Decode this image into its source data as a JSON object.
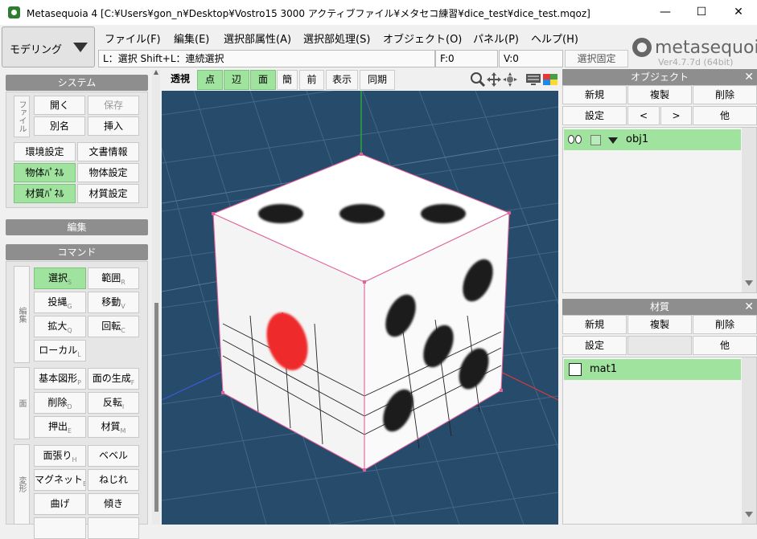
{
  "window": {
    "title": "Metasequoia 4 [C:¥Users¥gon_n¥Desktop¥Vostro15 3000 アクティブファイル¥メタセコ練習¥dice_test¥dice_test.mqoz]",
    "minimize": "—",
    "maximize": "☐",
    "close": "✕"
  },
  "mode": {
    "label": "モデリング"
  },
  "menu": [
    "ファイル(F)",
    "編集(E)",
    "選択部属性(A)",
    "選択部処理(S)",
    "オブジェクト(O)",
    "パネル(P)",
    "ヘルプ(H)"
  ],
  "logo": {
    "name": "metasequoia",
    "num": "4",
    "version": "Ver4.7.7d (64bit)"
  },
  "status": {
    "hint": "L：選択  Shift+L：連続選択",
    "faces": "F:0",
    "verts": "V:0",
    "lock_button": "選択固定"
  },
  "system_panel": {
    "header": "システム",
    "file_label": "ファイル",
    "open": "開く",
    "save": "保存",
    "save_as": "別名",
    "insert": "挿入",
    "env": "環境設定",
    "doc": "文書情報",
    "obj_panel": "物体ﾊﾟﾈﾙ",
    "obj_settings": "物体設定",
    "mat_panel": "材質ﾊﾟﾈﾙ",
    "mat_settings": "材質設定"
  },
  "edit_panel": {
    "header": "編集"
  },
  "command_panel": {
    "header": "コマンド",
    "group1_label": "編集",
    "group2_label": "面",
    "group3_label": "変形",
    "select": "選択",
    "select_key": "S",
    "range": "範囲",
    "range_key": "R",
    "lasso": "投縄",
    "lasso_key": "G",
    "move": "移動",
    "move_key": "V",
    "scale": "拡大",
    "scale_key": "Q",
    "rotate": "回転",
    "rotate_key": "C",
    "local": "ローカル",
    "local_key": "L",
    "primitive": "基本図形",
    "primitive_key": "P",
    "face_gen": "面の生成",
    "face_gen_key": "F",
    "delete": "削除",
    "delete_key": "D",
    "invert": "反転",
    "invert_key": "I",
    "extrude": "押出",
    "extrude_key": "E",
    "material": "材質",
    "material_key": "M",
    "facepaste": "面張り",
    "facepaste_key": "H",
    "bevel": "ベベル",
    "magnet": "マグネット",
    "magnet_key": "B",
    "twist": "ねじれ",
    "bend": "曲げ",
    "tilt": "傾き"
  },
  "view_toolbar": {
    "perspective": "透視",
    "point": "点",
    "edge": "辺",
    "face": "面",
    "simple": "簡",
    "front": "前",
    "display": "表示",
    "sync": "同期"
  },
  "object_panel": {
    "header": "オブジェクト",
    "new": "新規",
    "dup": "複製",
    "del": "削除",
    "settings": "設定",
    "prev": "<",
    "next": ">",
    "other": "他",
    "items": [
      {
        "name": "obj1"
      }
    ]
  },
  "material_panel": {
    "header": "材質",
    "new": "新規",
    "dup": "複製",
    "del": "削除",
    "settings": "設定",
    "other": "他",
    "items": [
      {
        "name": "mat1"
      }
    ]
  },
  "colors": {
    "accent_green": "#9fe39f",
    "viewport_bg": "#264b6b",
    "panel_header": "#8e8e8e"
  }
}
